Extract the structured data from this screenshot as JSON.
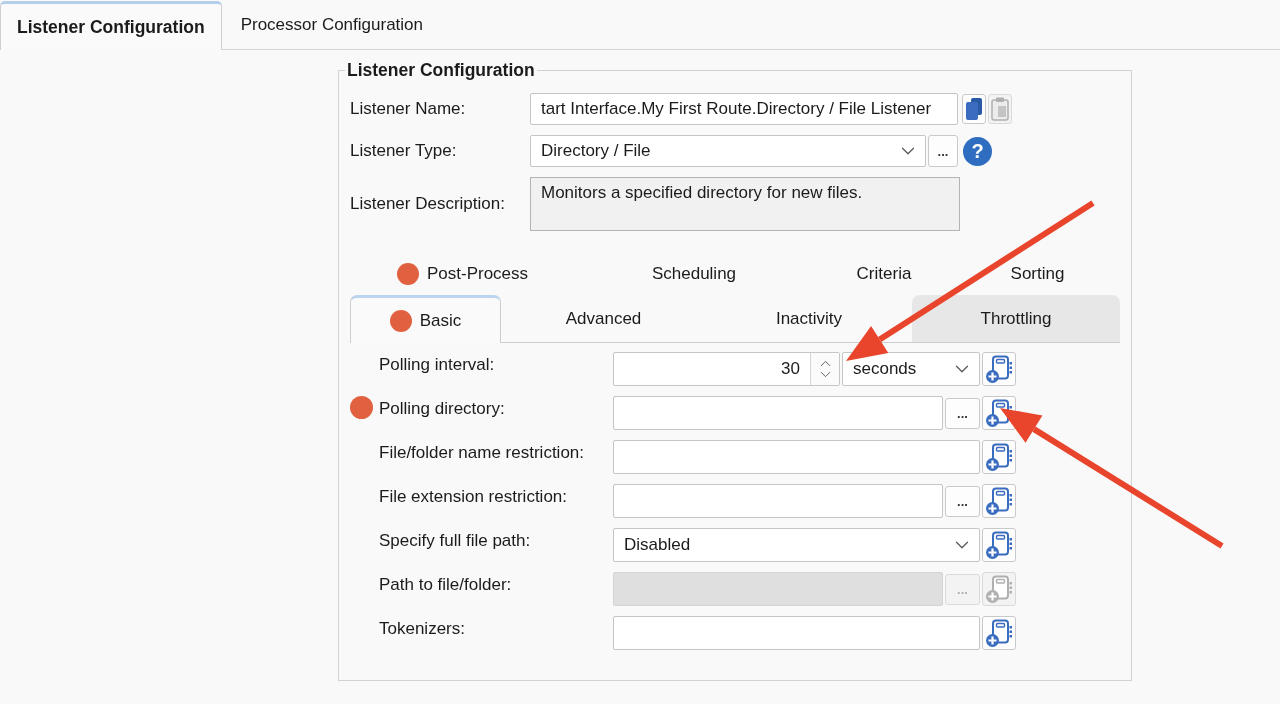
{
  "top_tabs": [
    {
      "label": "Listener Configuration",
      "selected": true
    },
    {
      "label": "Processor Configuration",
      "selected": false
    }
  ],
  "listener": {
    "legend": "Listener Configuration",
    "name": {
      "label": "Listener Name:",
      "value": "tart Interface.My First Route.Directory / File Listener"
    },
    "clipboard_buttons": [
      {
        "kind": "copy",
        "disabled": false
      },
      {
        "kind": "paste",
        "disabled": true
      }
    ],
    "type": {
      "label": "Listener Type:",
      "value": "Directory / File",
      "browse": "...",
      "help": "?"
    },
    "description": {
      "label": "Listener Description:",
      "value": "Monitors a specified directory for new files."
    }
  },
  "tab_rows": [
    {
      "tabs": [
        {
          "label": "Post-Process",
          "selected": false,
          "flagged": true,
          "hovered": false
        },
        {
          "label": "Scheduling",
          "selected": false,
          "flagged": false,
          "hovered": false
        },
        {
          "label": "Criteria",
          "selected": false,
          "flagged": false,
          "hovered": false
        },
        {
          "label": "Sorting",
          "selected": false,
          "flagged": false,
          "hovered": false
        }
      ]
    },
    {
      "tabs": [
        {
          "label": "Basic",
          "selected": true,
          "flagged": true,
          "hovered": false
        },
        {
          "label": "Advanced",
          "selected": false,
          "flagged": false,
          "hovered": false
        },
        {
          "label": "Inactivity",
          "selected": false,
          "flagged": false,
          "hovered": false
        },
        {
          "label": "Throttling",
          "selected": false,
          "flagged": false,
          "hovered": true
        }
      ]
    }
  ],
  "form_rows": [
    {
      "kind": "spinner",
      "label": "Polling interval:",
      "value": "30",
      "unit": "seconds",
      "flagged": false,
      "disabled": false
    },
    {
      "kind": "text",
      "label": "Polling directory:",
      "browse": "...",
      "flagged": true,
      "disabled": false
    },
    {
      "kind": "text",
      "label": "File/folder name restriction:",
      "flagged": false,
      "disabled": false
    },
    {
      "kind": "text",
      "label": "File extension restriction:",
      "browse": "...",
      "flagged": false,
      "disabled": false
    },
    {
      "kind": "select",
      "label": "Specify full file path:",
      "value": "Disabled",
      "flagged": false,
      "disabled": false
    },
    {
      "kind": "text",
      "label": "Path to file/folder:",
      "browse": "...",
      "flagged": false,
      "disabled": true
    },
    {
      "kind": "text",
      "label": "Tokenizers:",
      "flagged": false,
      "disabled": false
    }
  ],
  "annotations": [
    {
      "kind": "arrow"
    },
    {
      "kind": "arrow"
    }
  ]
}
